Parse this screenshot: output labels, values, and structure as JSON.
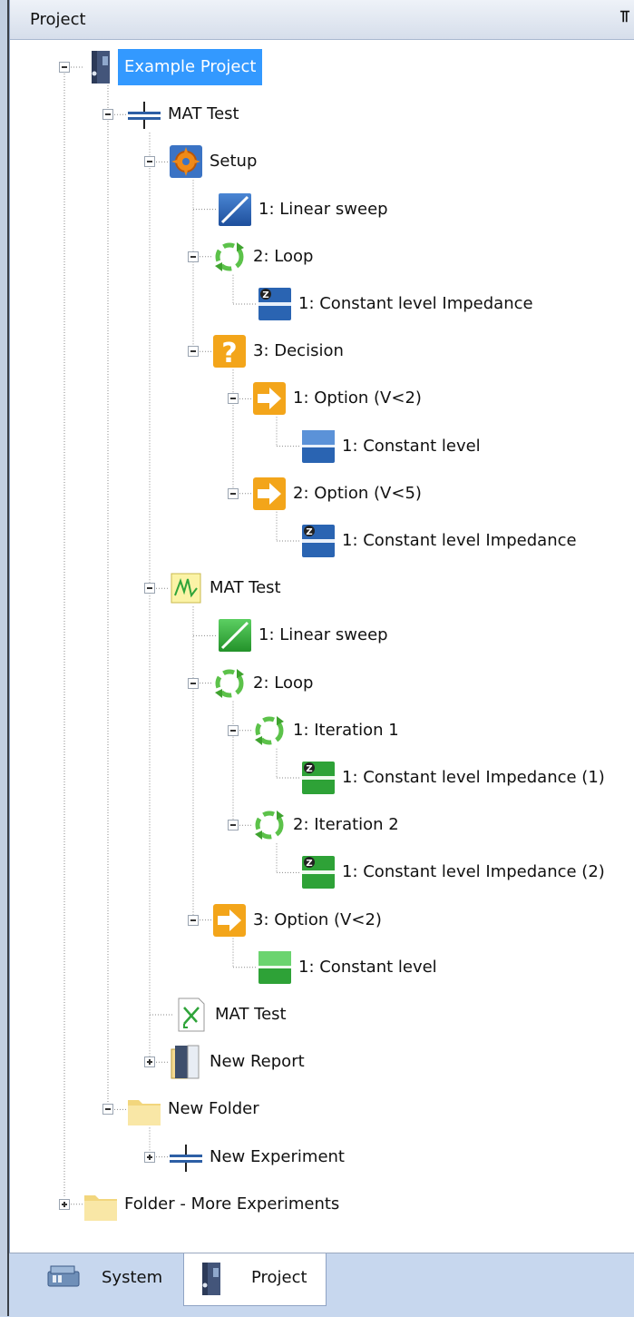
{
  "panel": {
    "title": "Project",
    "pin_glyph": "ⴾ"
  },
  "tree": [
    {
      "label": "Example Project",
      "icon": "project-binder-icon",
      "selected": true
    },
    {
      "label": "MAT Test",
      "icon": "experiment-icon"
    },
    {
      "label": "Setup",
      "icon": "setup-gear-icon"
    },
    {
      "label": "1: Linear sweep",
      "icon": "linear-sweep-blue-icon"
    },
    {
      "label": "2: Loop",
      "icon": "loop-icon"
    },
    {
      "label": "1: Constant level Impedance",
      "icon": "impedance-blue-icon"
    },
    {
      "label": "3: Decision",
      "icon": "decision-icon"
    },
    {
      "label": "1: Option (V<2)",
      "icon": "option-arrow-icon"
    },
    {
      "label": "1: Constant level",
      "icon": "constant-level-blue-icon"
    },
    {
      "label": "2: Option (V<5)",
      "icon": "option-arrow-icon"
    },
    {
      "label": "1: Constant level Impedance",
      "icon": "impedance-blue-icon"
    },
    {
      "label": "MAT Test",
      "icon": "measurement-result-icon"
    },
    {
      "label": "1: Linear sweep",
      "icon": "linear-sweep-green-icon"
    },
    {
      "label": "2: Loop",
      "icon": "loop-icon"
    },
    {
      "label": "1: Iteration 1",
      "icon": "loop-icon"
    },
    {
      "label": "1: Constant level Impedance (1)",
      "icon": "impedance-green-icon"
    },
    {
      "label": "2: Iteration 2",
      "icon": "loop-icon"
    },
    {
      "label": "1: Constant level Impedance (2)",
      "icon": "impedance-green-icon"
    },
    {
      "label": "3: Option (V<2)",
      "icon": "option-arrow-icon"
    },
    {
      "label": "1: Constant level",
      "icon": "constant-level-green-icon"
    },
    {
      "label": "MAT Test",
      "icon": "analysis-icon"
    },
    {
      "label": "New Report",
      "icon": "report-icon"
    },
    {
      "label": "New Folder",
      "icon": "folder-icon"
    },
    {
      "label": "New Experiment",
      "icon": "experiment-icon"
    },
    {
      "label": "Folder - More Experiments",
      "icon": "folder-icon"
    }
  ],
  "tabs": [
    {
      "label": "System",
      "icon": "system-icon",
      "active": false
    },
    {
      "label": "Project",
      "icon": "project-binder-icon",
      "active": true
    }
  ]
}
